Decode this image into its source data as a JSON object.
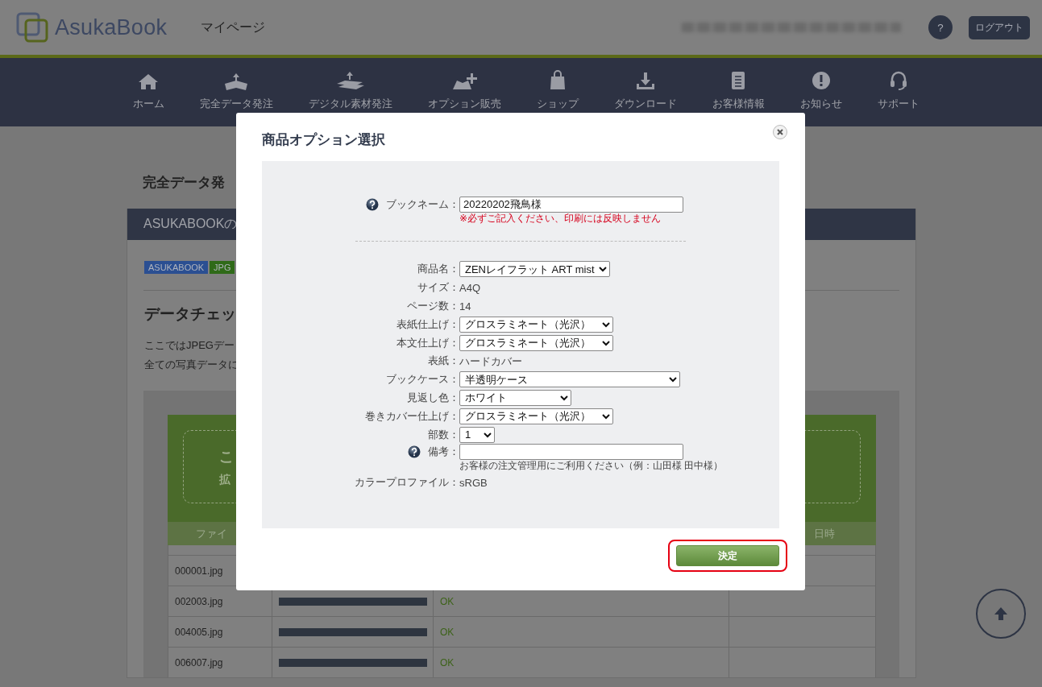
{
  "header": {
    "logo_text": "AsukaBook",
    "page_title": "マイページ",
    "help_button": "?",
    "logout_button": "ログアウト"
  },
  "nav": {
    "items": [
      {
        "label": "ホーム"
      },
      {
        "label": "完全データ発注"
      },
      {
        "label": "デジタル素材発注"
      },
      {
        "label": "オプション販売"
      },
      {
        "label": "ショップ"
      },
      {
        "label": "ダウンロード"
      },
      {
        "label": "お客様情報"
      },
      {
        "label": "お知らせ"
      },
      {
        "label": "サポート"
      }
    ]
  },
  "page": {
    "heading": "完全データ発",
    "section_title": "ASUKABOOKの",
    "tags": [
      {
        "label": "ASUKABOOK",
        "color": "#2b4f92"
      },
      {
        "label": "JPG",
        "color": "#2f6a18"
      }
    ],
    "subheading": "データチェッ",
    "paragraphs": [
      "ここではJPEGデー",
      "全ての写真データに"
    ],
    "dropzone": {
      "line_1": "こ",
      "line_2": "拡"
    },
    "table": {
      "column_1": "ファイ",
      "column_4": "日時",
      "rows": [
        {
          "file": "000001.jpg"
        },
        {
          "file": "002003.jpg",
          "level": 1,
          "status": "OK"
        },
        {
          "file": "004005.jpg",
          "level": 1,
          "status": "OK"
        },
        {
          "file": "006007.jpg",
          "level": 1,
          "status": "OK"
        }
      ]
    }
  },
  "dialog": {
    "title": "商品オプション選択",
    "fields": [
      {
        "kind": "text",
        "label": "ブックネーム：",
        "value": "20220202飛鳥様",
        "help": true,
        "note": "※必ずご記入ください、印刷には反映しません"
      },
      {
        "kind": "divider"
      },
      {
        "kind": "select",
        "label": "商品名：",
        "value": "ZENレイフラット ART mist"
      },
      {
        "kind": "static",
        "label": "サイズ：",
        "value": "A4Q"
      },
      {
        "kind": "static",
        "label": "ページ数：",
        "value": "14"
      },
      {
        "kind": "select",
        "label": "表紙仕上げ：",
        "value": "グロスラミネート（光沢）"
      },
      {
        "kind": "select",
        "label": "本文仕上げ：",
        "value": "グロスラミネート（光沢）"
      },
      {
        "kind": "static",
        "label": "表紙：",
        "value": "ハードカバー"
      },
      {
        "kind": "select",
        "label": "ブックケース：",
        "value": "半透明ケース"
      },
      {
        "kind": "select",
        "label": "見返し色：",
        "value": "ホワイト"
      },
      {
        "kind": "select",
        "label": "巻きカバー仕上げ：",
        "value": "グロスラミネート（光沢）"
      },
      {
        "kind": "select",
        "label": "部数：",
        "value": "1"
      },
      {
        "kind": "text",
        "label": "備考：",
        "help": true,
        "hint": "お客様の注文管理用にご利用ください（例：山田様 田中様）"
      },
      {
        "kind": "static",
        "label": "カラープロファイル：",
        "value": "sRGB"
      }
    ],
    "submit_button": "決定"
  }
}
